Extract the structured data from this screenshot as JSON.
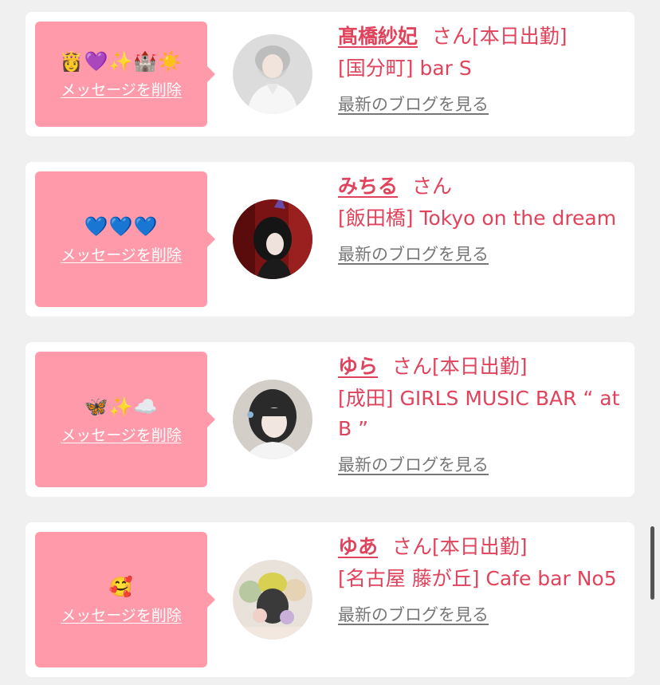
{
  "colors": {
    "bubble": "#ff9aab",
    "accent": "#e0435b",
    "link_gray": "#777777"
  },
  "delete_label": "メッセージを削除",
  "blog_label": "最新のブログを見る",
  "items": [
    {
      "emoji": "👸💜✨🏰☀️",
      "name": "髙橋紗妃",
      "suffix": "さん[本日出勤]",
      "shop": "[国分町] bar S"
    },
    {
      "emoji": "💙💙💙",
      "name": "みちる",
      "suffix": "さん",
      "shop": "[飯田橋] Tokyo on the dream"
    },
    {
      "emoji": "🦋✨☁️",
      "name": "ゆら",
      "suffix": "さん[本日出勤]",
      "shop": "[成田] GIRLS MUSIC BAR “ at B ”"
    },
    {
      "emoji": "🥰",
      "name": "ゆあ",
      "suffix": "さん[本日出勤]",
      "shop": "[名古屋 藤が丘] Cafe bar No5"
    }
  ]
}
